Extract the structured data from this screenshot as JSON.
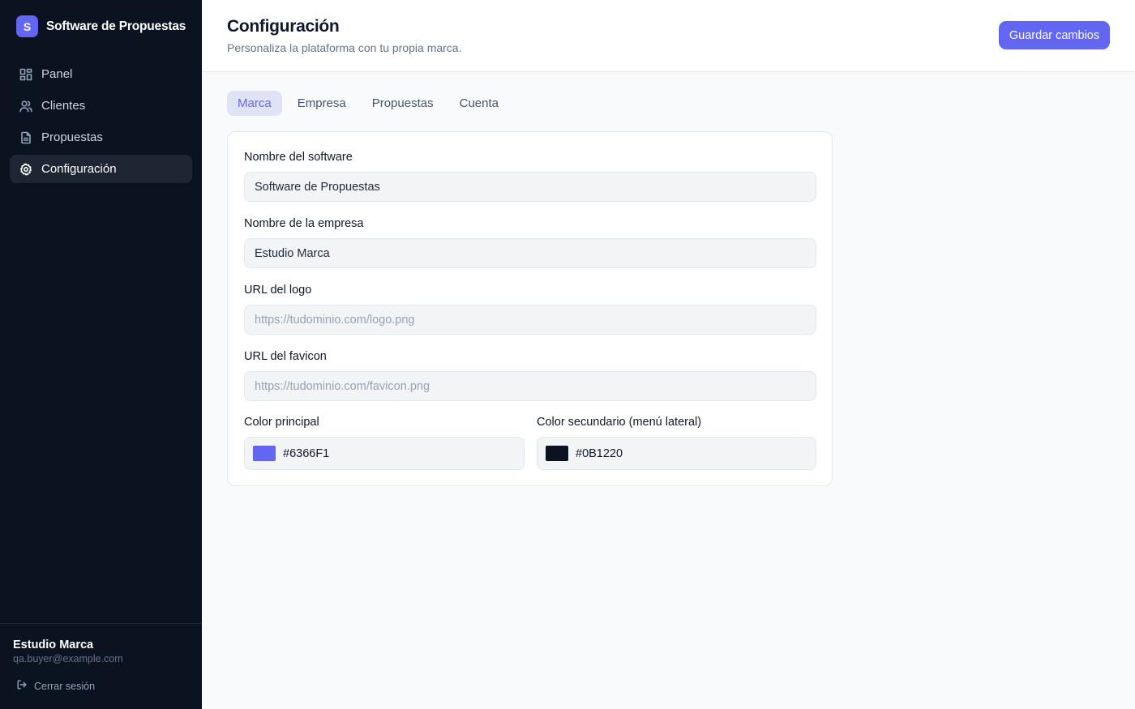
{
  "app": {
    "logo_letter": "S",
    "name": "Software de Propuestas"
  },
  "sidebar": {
    "items": [
      {
        "label": "Panel",
        "icon": "grid-icon",
        "active": false
      },
      {
        "label": "Clientes",
        "icon": "users-icon",
        "active": false
      },
      {
        "label": "Propuestas",
        "icon": "document-icon",
        "active": false
      },
      {
        "label": "Configuración",
        "icon": "gear-icon",
        "active": true
      }
    ],
    "user": {
      "name": "Estudio Marca",
      "email": "qa.buyer@example.com"
    },
    "logout_label": "Cerrar sesión"
  },
  "header": {
    "title": "Configuración",
    "subtitle": "Personaliza la plataforma con tu propia marca.",
    "save_label": "Guardar cambios"
  },
  "tabs": [
    {
      "label": "Marca",
      "active": true
    },
    {
      "label": "Empresa",
      "active": false
    },
    {
      "label": "Propuestas",
      "active": false
    },
    {
      "label": "Cuenta",
      "active": false
    }
  ],
  "form": {
    "software_name": {
      "label": "Nombre del software",
      "value": "Software de Propuestas",
      "placeholder": ""
    },
    "company_name": {
      "label": "Nombre de la empresa",
      "value": "Estudio Marca",
      "placeholder": ""
    },
    "logo_url": {
      "label": "URL del logo",
      "value": "",
      "placeholder": "https://tudominio.com/logo.png"
    },
    "favicon_url": {
      "label": "URL del favicon",
      "value": "",
      "placeholder": "https://tudominio.com/favicon.png"
    },
    "primary_color": {
      "label": "Color principal",
      "value": "#6366F1"
    },
    "secondary_color": {
      "label": "Color secundario (menú lateral)",
      "value": "#0B1220"
    }
  },
  "colors": {
    "accent": "#6366F1",
    "sidebar": "#0B1220"
  }
}
